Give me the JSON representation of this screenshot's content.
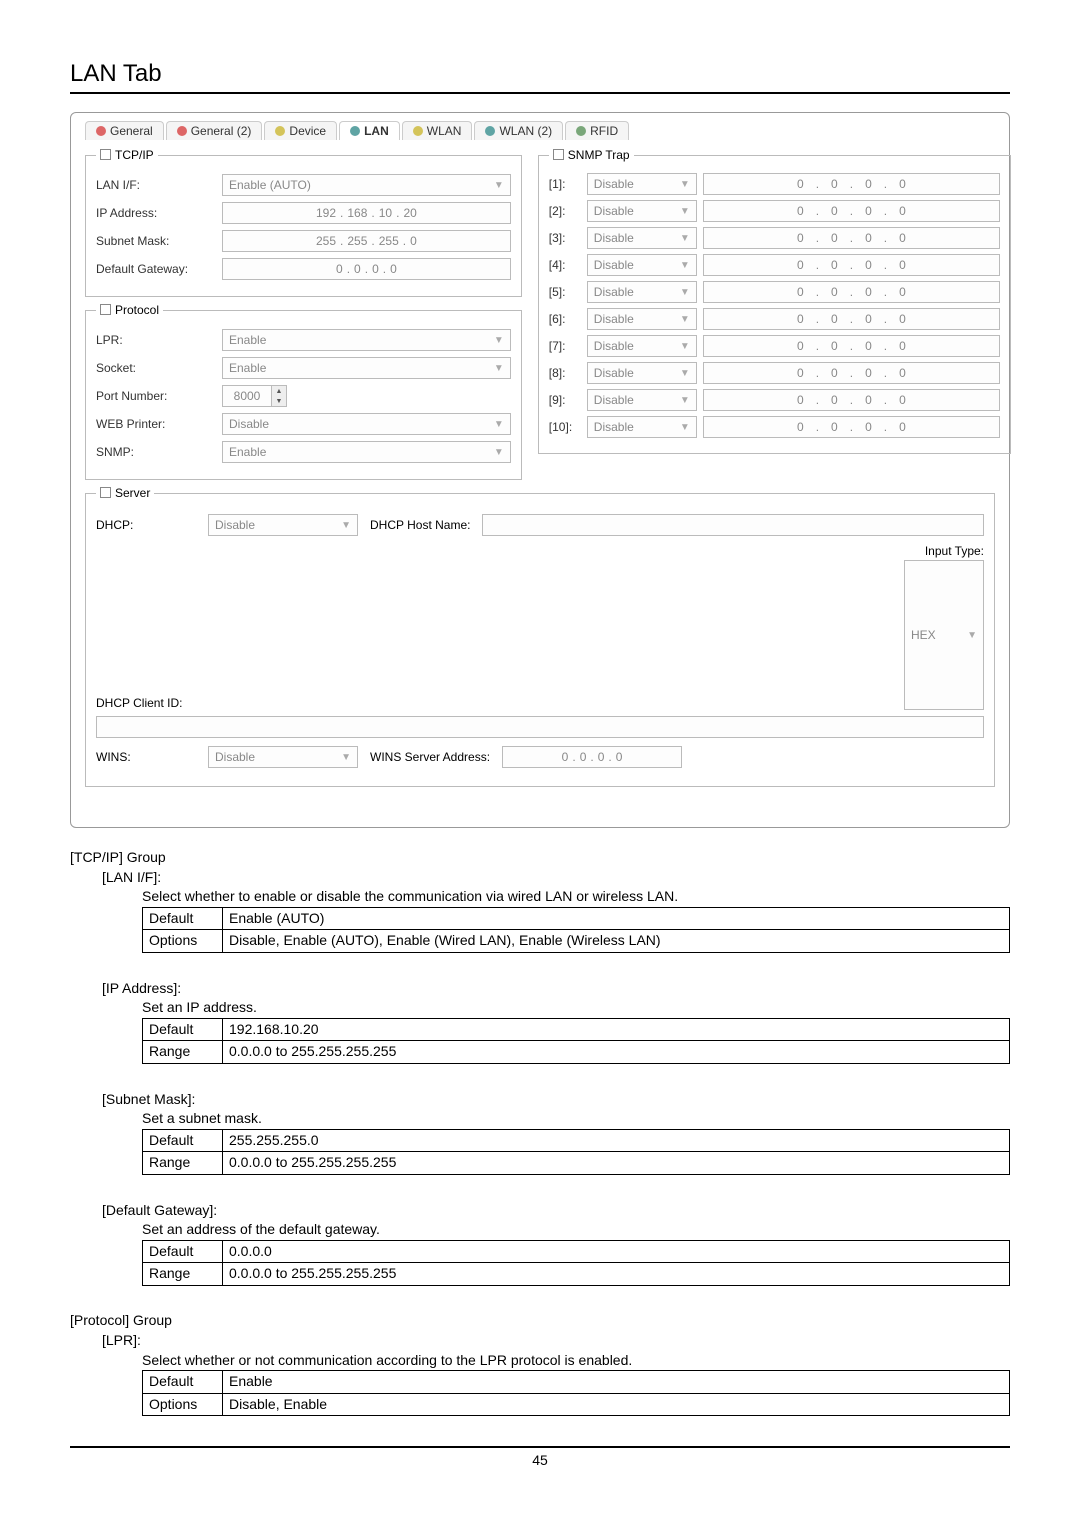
{
  "page": {
    "title": "LAN Tab",
    "number": "45"
  },
  "tabs": [
    {
      "label": "General",
      "dot": "red"
    },
    {
      "label": "General (2)",
      "dot": "red"
    },
    {
      "label": "Device",
      "dot": "yellow"
    },
    {
      "label": "LAN",
      "dot": "teal",
      "active": true
    },
    {
      "label": "WLAN",
      "dot": "yellow"
    },
    {
      "label": "WLAN (2)",
      "dot": "teal"
    },
    {
      "label": "RFID",
      "dot": "green"
    }
  ],
  "groups": {
    "tcpip": "TCP/IP",
    "snmptrap": "SNMP Trap",
    "protocol": "Protocol",
    "server": "Server"
  },
  "tcpip": {
    "lanif_label": "LAN I/F:",
    "lanif_value": "Enable (AUTO)",
    "ip_label": "IP Address:",
    "ip_value": [
      "192",
      "168",
      "10",
      "20"
    ],
    "subnet_label": "Subnet Mask:",
    "subnet_value": [
      "255",
      "255",
      "255",
      "0"
    ],
    "gateway_label": "Default Gateway:",
    "gateway_value": [
      "0",
      "0",
      "0",
      "0"
    ]
  },
  "protocol": {
    "lpr_label": "LPR:",
    "lpr_value": "Enable",
    "socket_label": "Socket:",
    "socket_value": "Enable",
    "port_label": "Port Number:",
    "port_value": "8000",
    "web_label": "WEB Printer:",
    "web_value": "Disable",
    "snmp_label": "SNMP:",
    "snmp_value": "Enable"
  },
  "snmptrap": {
    "items": [
      {
        "idx": "[1]:",
        "value": "Disable",
        "ip": [
          "0",
          "0",
          "0",
          "0"
        ]
      },
      {
        "idx": "[2]:",
        "value": "Disable",
        "ip": [
          "0",
          "0",
          "0",
          "0"
        ]
      },
      {
        "idx": "[3]:",
        "value": "Disable",
        "ip": [
          "0",
          "0",
          "0",
          "0"
        ]
      },
      {
        "idx": "[4]:",
        "value": "Disable",
        "ip": [
          "0",
          "0",
          "0",
          "0"
        ]
      },
      {
        "idx": "[5]:",
        "value": "Disable",
        "ip": [
          "0",
          "0",
          "0",
          "0"
        ]
      },
      {
        "idx": "[6]:",
        "value": "Disable",
        "ip": [
          "0",
          "0",
          "0",
          "0"
        ]
      },
      {
        "idx": "[7]:",
        "value": "Disable",
        "ip": [
          "0",
          "0",
          "0",
          "0"
        ]
      },
      {
        "idx": "[8]:",
        "value": "Disable",
        "ip": [
          "0",
          "0",
          "0",
          "0"
        ]
      },
      {
        "idx": "[9]:",
        "value": "Disable",
        "ip": [
          "0",
          "0",
          "0",
          "0"
        ]
      },
      {
        "idx": "[10]:",
        "value": "Disable",
        "ip": [
          "0",
          "0",
          "0",
          "0"
        ]
      }
    ]
  },
  "server": {
    "dhcp_label": "DHCP:",
    "dhcp_value": "Disable",
    "dhcp_host_label": "DHCP Host Name:",
    "clientid_label": "DHCP Client ID:",
    "inputtype_label": "Input Type:",
    "inputtype_value": "HEX",
    "wins_label": "WINS:",
    "wins_value": "Disable",
    "wins_addr_label": "WINS Server Address:",
    "wins_addr": [
      "0",
      "0",
      "0",
      "0"
    ]
  },
  "doc": {
    "tcpip_group": "[TCP/IP] Group",
    "lanif_head": "[LAN I/F]:",
    "lanif_desc": "Select whether to enable or disable the communication via wired LAN or wireless LAN.",
    "lanif_default": "Enable (AUTO)",
    "lanif_options": "Disable, Enable (AUTO), Enable (Wired LAN), Enable (Wireless LAN)",
    "ipaddr_head": "[IP Address]:",
    "ipaddr_desc": "Set an IP address.",
    "ipaddr_default": "192.168.10.20",
    "ipaddr_range": "0.0.0.0 to 255.255.255.255",
    "subnet_head": "[Subnet Mask]:",
    "subnet_desc": "Set a subnet mask.",
    "subnet_default": "255.255.255.0",
    "subnet_range": "0.0.0.0 to 255.255.255.255",
    "gateway_head": "[Default Gateway]:",
    "gateway_desc": "Set an address of the default gateway.",
    "gateway_default": "0.0.0.0",
    "gateway_range": "0.0.0.0 to 255.255.255.255",
    "protocol_group": "[Protocol] Group",
    "lpr_head": "[LPR]:",
    "lpr_desc": "Select whether or not communication according to the LPR protocol is enabled.",
    "lpr_default": "Enable",
    "lpr_options": "Disable, Enable",
    "row_default": "Default",
    "row_options": "Options",
    "row_range": "Range"
  }
}
